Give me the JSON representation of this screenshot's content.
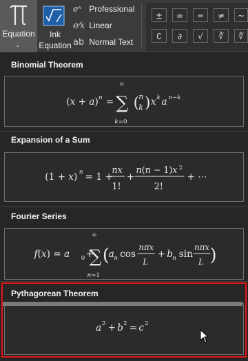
{
  "ribbon": {
    "equation_label": "Equation",
    "ink_label_1": "Ink",
    "ink_label_2": "Equation",
    "formats": [
      {
        "glyph": "eˣ",
        "label": "Professional"
      },
      {
        "glyph": "e⁄x",
        "label": "Linear"
      },
      {
        "glyph": "ab",
        "label": "Normal Text"
      }
    ],
    "symbols_row1": [
      "±",
      "∞",
      "=",
      "≠",
      "~"
    ],
    "symbols_row2": [
      "∁",
      "∂",
      "√",
      "∛",
      "∜"
    ]
  },
  "gallery": {
    "items": [
      {
        "title": "Binomial Theorem"
      },
      {
        "title": "Expansion of a Sum"
      },
      {
        "title": "Fourier Series"
      },
      {
        "title": "Pythagorean Theorem"
      }
    ]
  },
  "colors": {
    "selection": "#e0161b",
    "ribbon_bg": "#3b3b3b",
    "panel_bg": "#262626"
  }
}
